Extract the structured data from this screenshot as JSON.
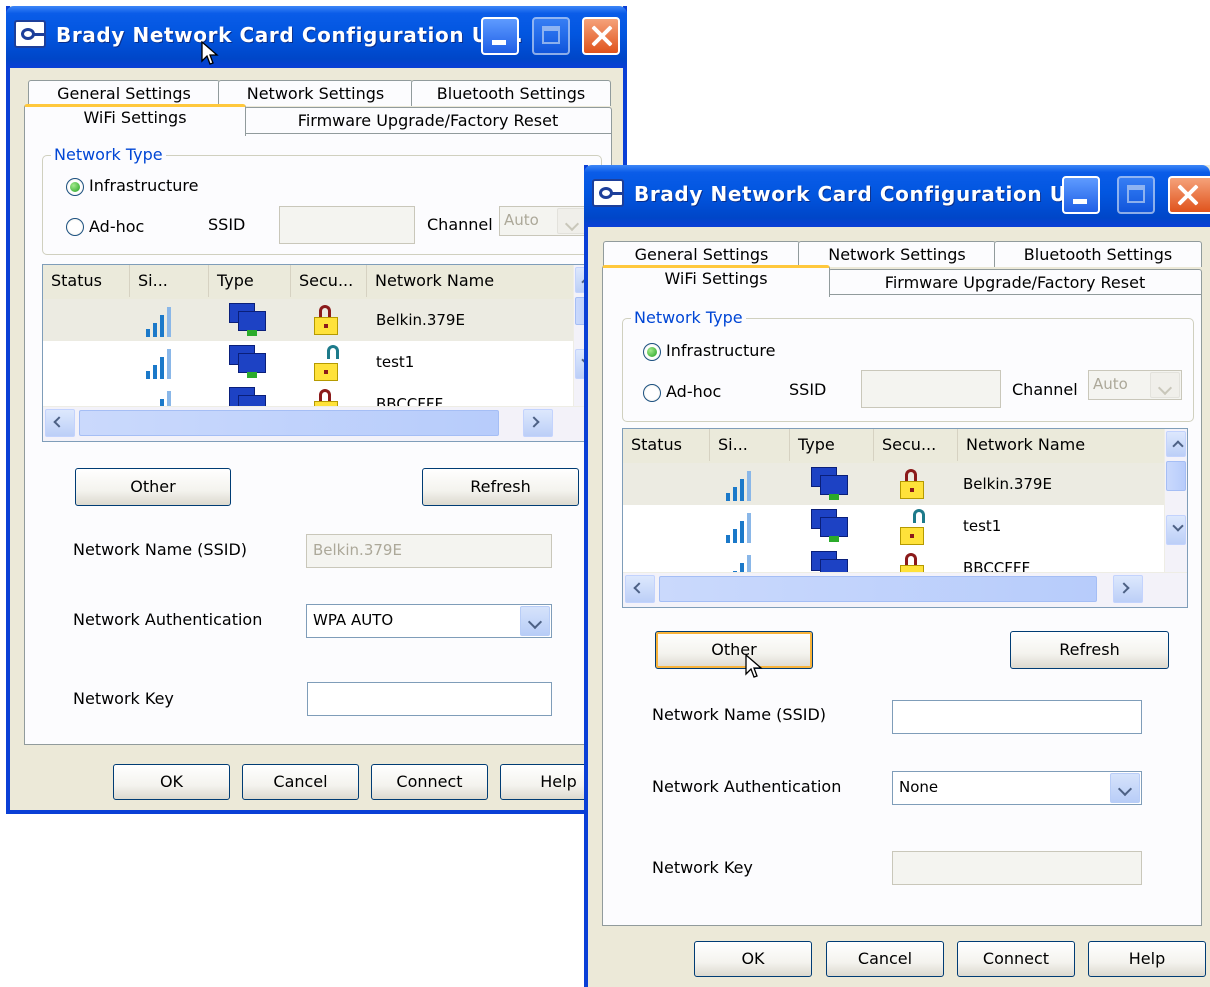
{
  "windows": [
    {
      "title": "Brady Network Card Configuration Ut...",
      "tabs_row1": [
        "General Settings",
        "Network Settings",
        "Bluetooth Settings"
      ],
      "tabs_row2": [
        "WiFi Settings",
        "Firmware Upgrade/Factory Reset"
      ],
      "network_type": {
        "legend": "Network Type",
        "infrastructure": "Infrastructure",
        "adhoc": "Ad-hoc",
        "ssid_label": "SSID",
        "channel_label": "Channel",
        "channel_value": "Auto",
        "selected": "infrastructure"
      },
      "columns": [
        "Status",
        "Si...",
        "Type",
        "Secu...",
        "Network Name"
      ],
      "networks": [
        {
          "name": "Belkin.379E",
          "security": "locked",
          "selected": true
        },
        {
          "name": "test1",
          "security": "open",
          "selected": false
        },
        {
          "name": "BBCCFFF",
          "security": "locked",
          "selected": false
        }
      ],
      "other_button": "Other",
      "refresh_button": "Refresh",
      "fields": {
        "ssid_label": "Network Name (SSID)",
        "ssid_value": "Belkin.379E",
        "auth_label": "Network Authentication",
        "auth_value": "WPA AUTO",
        "key_label": "Network Key",
        "key_value": ""
      },
      "footer": [
        "OK",
        "Cancel",
        "Connect",
        "Help"
      ]
    },
    {
      "title": "Brady Network Card Configuration Ut...",
      "tabs_row1": [
        "General Settings",
        "Network Settings",
        "Bluetooth Settings"
      ],
      "tabs_row2": [
        "WiFi Settings",
        "Firmware Upgrade/Factory Reset"
      ],
      "network_type": {
        "legend": "Network Type",
        "infrastructure": "Infrastructure",
        "adhoc": "Ad-hoc",
        "ssid_label": "SSID",
        "channel_label": "Channel",
        "channel_value": "Auto",
        "selected": "infrastructure"
      },
      "columns": [
        "Status",
        "Si...",
        "Type",
        "Secu...",
        "Network Name"
      ],
      "networks": [
        {
          "name": "Belkin.379E",
          "security": "locked",
          "selected": true
        },
        {
          "name": "test1",
          "security": "open",
          "selected": false
        },
        {
          "name": "BBCCFFF",
          "security": "locked",
          "selected": false
        }
      ],
      "other_button": "Other",
      "refresh_button": "Refresh",
      "fields": {
        "ssid_label": "Network Name (SSID)",
        "ssid_value": "",
        "auth_label": "Network Authentication",
        "auth_value": "None",
        "key_label": "Network Key",
        "key_value": ""
      },
      "footer": [
        "OK",
        "Cancel",
        "Connect",
        "Help"
      ]
    }
  ]
}
